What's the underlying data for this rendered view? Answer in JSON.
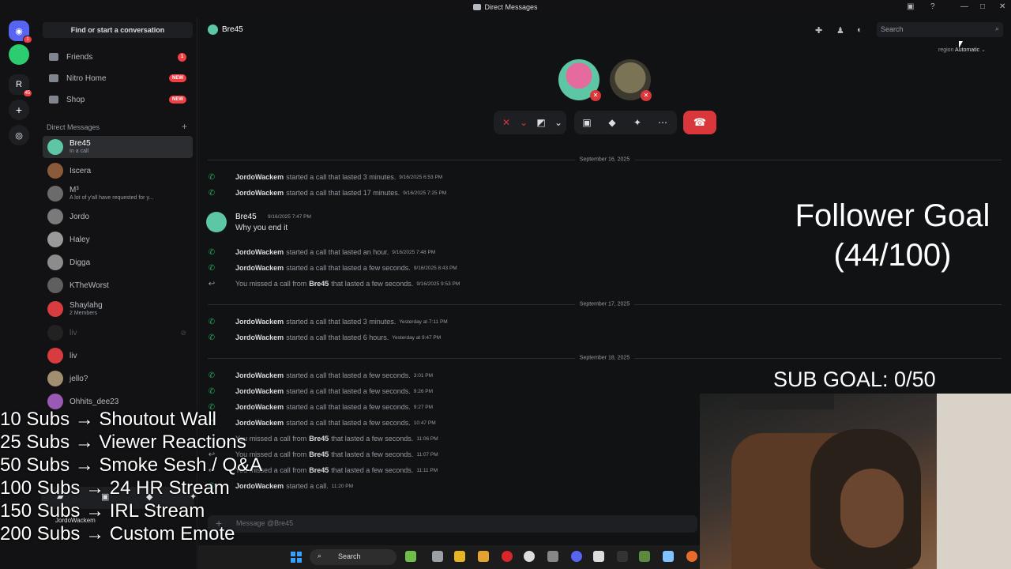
{
  "window": {
    "title": "Direct Messages"
  },
  "rail": {
    "dm_badge": "1",
    "server_badge": "45",
    "server_letter": "R"
  },
  "sidebar": {
    "find_button": "Find or start a conversation",
    "nav": [
      {
        "label": "Friends",
        "badge": "1"
      },
      {
        "label": "Nitro Home",
        "badge": "NEW"
      },
      {
        "label": "Shop",
        "badge": "NEW"
      }
    ],
    "dm_header": "Direct Messages",
    "dms": [
      {
        "name": "Bre45",
        "sub": "In a call",
        "color": "#5dc7a5"
      },
      {
        "name": "Iscera",
        "sub": "",
        "color": "#8a5a3a"
      },
      {
        "name": "M³",
        "sub": "A lot of y'all have requested for y...",
        "color": "#6b6b6b"
      },
      {
        "name": "Jordo",
        "sub": "",
        "color": "#7a7a7a"
      },
      {
        "name": "Haley",
        "sub": "",
        "color": "#9a9a9a"
      },
      {
        "name": "Digga",
        "sub": "",
        "color": "#8c8c8c"
      },
      {
        "name": "KTheWorst",
        "sub": "",
        "color": "#5f5f5f"
      },
      {
        "name": "Shaylahg",
        "sub": "2 Members",
        "color": "#d83c3e"
      },
      {
        "name": "liv",
        "sub": "",
        "color": "#3a3a3a"
      },
      {
        "name": "liv",
        "sub": "",
        "color": "#d83c3e"
      },
      {
        "name": "jello?",
        "sub": "",
        "color": "#a09070"
      },
      {
        "name": "Ohhits_dee23",
        "sub": "",
        "color": "#9b59b6"
      }
    ]
  },
  "header": {
    "name": "Bre45",
    "search_placeholder": "Search",
    "region_label": "region",
    "region_value": "Automatic"
  },
  "messages": {
    "dates": [
      "September 16, 2025",
      "September 17, 2025",
      "September 18, 2025"
    ],
    "main_message": {
      "author": "Bre45",
      "time": "9/16/2025 7:47 PM",
      "text": "Why you end it"
    },
    "system": [
      {
        "who": "JordoWackem",
        "text": "started a call that lasted 3 minutes.",
        "time": "9/16/2025 6:53 PM",
        "missed": false
      },
      {
        "who": "JordoWackem",
        "text": "started a call that lasted 17 minutes.",
        "time": "9/16/2025 7:25 PM",
        "missed": false
      },
      {
        "who": "JordoWackem",
        "text": "started a call that lasted an hour.",
        "time": "9/16/2025 7:48 PM",
        "missed": false
      },
      {
        "who": "JordoWackem",
        "text": "started a call that lasted a few seconds.",
        "time": "9/16/2025 8:43 PM",
        "missed": false
      },
      {
        "who": "You missed a call from",
        "who2": "Bre45",
        "text": "that lasted a few seconds.",
        "time": "9/16/2025 9:53 PM",
        "missed": true
      },
      {
        "who": "JordoWackem",
        "text": "started a call that lasted 3 minutes.",
        "time": "Yesterday at 7:11 PM",
        "missed": false
      },
      {
        "who": "JordoWackem",
        "text": "started a call that lasted 6 hours.",
        "time": "Yesterday at 9:47 PM",
        "missed": false
      },
      {
        "who": "JordoWackem",
        "text": "started a call that lasted a few seconds.",
        "time": "3:01 PM",
        "missed": false
      },
      {
        "who": "JordoWackem",
        "text": "started a call that lasted a few seconds.",
        "time": "9:26 PM",
        "missed": false
      },
      {
        "who": "JordoWackem",
        "text": "started a call that lasted a few seconds.",
        "time": "9:27 PM",
        "missed": false
      },
      {
        "who": "JordoWackem",
        "text": "started a call that lasted a few seconds.",
        "time": "10:47 PM",
        "missed": false
      },
      {
        "who": "You missed a call from",
        "who2": "Bre45",
        "text": "that lasted a few seconds.",
        "time": "11:06 PM",
        "missed": true
      },
      {
        "who": "You missed a call from",
        "who2": "Bre45",
        "text": "that lasted a few seconds.",
        "time": "11:07 PM",
        "missed": true
      },
      {
        "who": "You missed a call from",
        "who2": "Bre45",
        "text": "that lasted a few seconds.",
        "time": "11:11 PM",
        "missed": true
      },
      {
        "who": "JordoWackem",
        "text": "started a call.",
        "time": "11:20 PM",
        "missed": false
      }
    ]
  },
  "composer": {
    "placeholder": "Message @Bre45"
  },
  "user_panel": {
    "name": "JordoWackem"
  },
  "overlay": {
    "follower_goal_title": "Follower Goal",
    "follower_goal_value": "(44/100)",
    "sub_goal": "SUB GOAL: 0/50",
    "rewards": [
      "10 Subs → Shoutout Wall",
      "25 Subs → Viewer Reactions",
      "50 Subs → Smoke Sesh / Q&A",
      "100 Subs → 24 HR Stream",
      "150 Subs → IRL Stream",
      "200 Subs → Custom Emote"
    ]
  },
  "taskbar": {
    "search_label": "Search"
  },
  "colors": {
    "accent": "#5865f2",
    "danger": "#da373c",
    "online": "#23a55a",
    "bg": "#111214"
  }
}
